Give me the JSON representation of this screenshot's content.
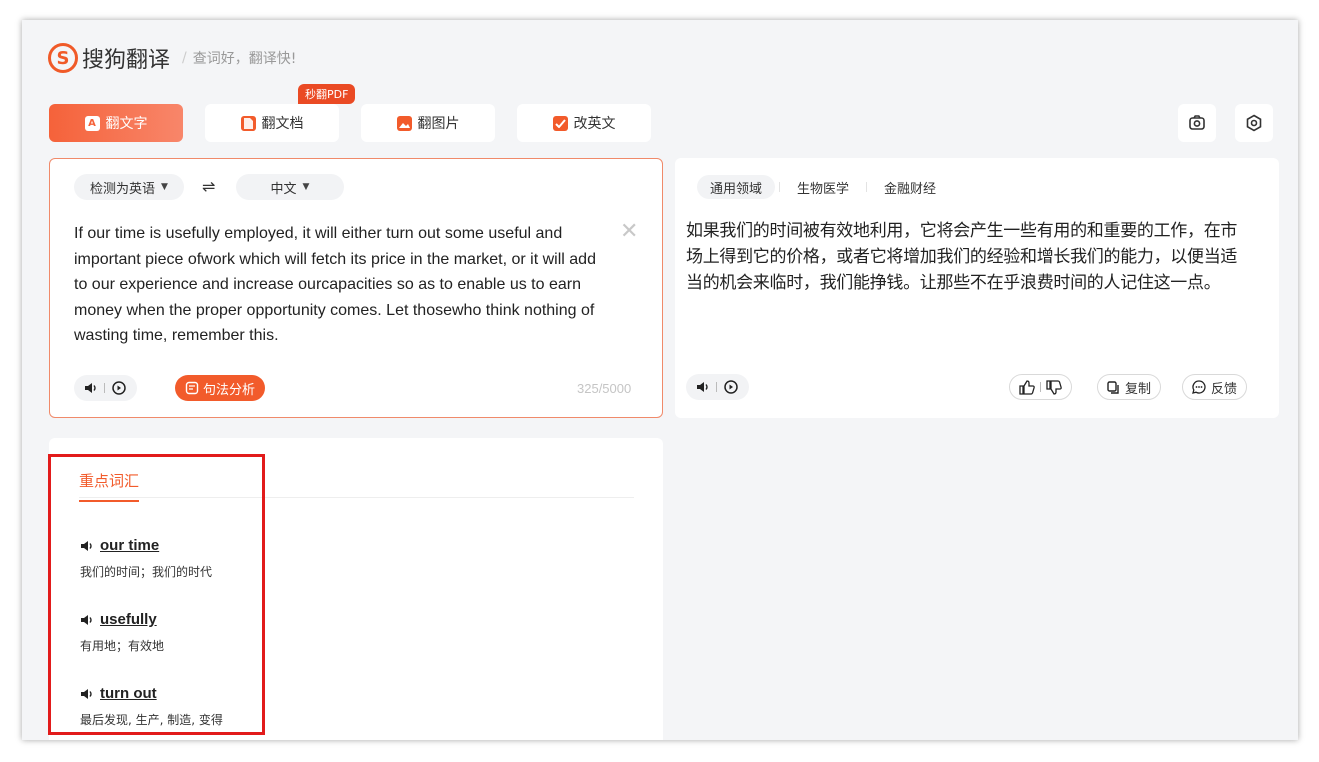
{
  "header": {
    "logo_mark": "S",
    "logo_text": "搜狗翻译",
    "separator": "/",
    "slogan": "查词好，翻译快!"
  },
  "mode_tabs": [
    {
      "label": "翻文字",
      "icon": "text-translate-icon",
      "glyph": "A",
      "active": true
    },
    {
      "label": "翻文档",
      "icon": "document-icon",
      "glyph": "",
      "active": false
    },
    {
      "label": "翻图片",
      "icon": "image-icon",
      "glyph": "",
      "active": false
    },
    {
      "label": "改英文",
      "icon": "edit-english-icon",
      "glyph": "",
      "active": false
    }
  ],
  "pdf_badge": "秒翻PDF",
  "top_icons": [
    "camera-icon",
    "settings-icon"
  ],
  "source": {
    "lang_detect": "检测为英语",
    "swap": "⇌",
    "target_lang": "中文",
    "text": "If our time is usefully employed, it will either turn out some useful and important piece ofwork which will fetch its price in the market, or it will add to our experience and increase ourcapacities so as to enable us to earn money when the proper opportunity comes. Let thosewho think nothing of wasting time, remember this.",
    "syntax_label": "句法分析",
    "char_count": "325/5000"
  },
  "target": {
    "domains": [
      {
        "label": "通用领域",
        "active": true
      },
      {
        "label": "生物医学",
        "active": false
      },
      {
        "label": "金融财经",
        "active": false
      }
    ],
    "text": "如果我们的时间被有效地利用，它将会产生一些有用的和重要的工作，在市场上得到它的价格，或者它将增加我们的经验和增长我们的能力，以便当适当的机会来临时，我们能挣钱。让那些不在乎浪费时间的人记住这一点。",
    "copy_label": "复制",
    "feedback_label": "反馈"
  },
  "vocab": {
    "tab_label": "重点词汇",
    "items": [
      {
        "word": "our time",
        "definition": "我们的时间；我们的时代"
      },
      {
        "word": "usefully",
        "definition": "有用地；有效地"
      },
      {
        "word": "turn out",
        "definition": "最后发现, 生产, 制造, 变得"
      }
    ]
  },
  "colors": {
    "accent": "#f25b2b",
    "highlight_box": "#e21b1b"
  }
}
